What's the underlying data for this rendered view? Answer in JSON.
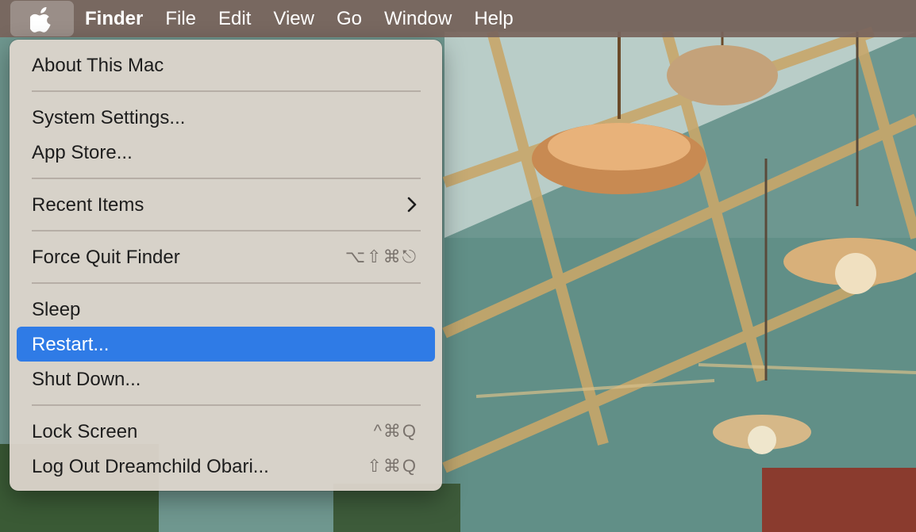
{
  "menubar": {
    "app_name": "Finder",
    "menus": [
      "File",
      "Edit",
      "View",
      "Go",
      "Window",
      "Help"
    ]
  },
  "apple_menu": {
    "items": [
      {
        "label": "About This Mac",
        "shortcut": ""
      },
      {
        "label": "System Settings...",
        "shortcut": ""
      },
      {
        "label": "App Store...",
        "shortcut": ""
      },
      {
        "label": "Recent Items",
        "shortcut": ""
      },
      {
        "label": "Force Quit Finder",
        "shortcut": "⌥⇧⌘⎋"
      },
      {
        "label": "Sleep",
        "shortcut": ""
      },
      {
        "label": "Restart...",
        "shortcut": ""
      },
      {
        "label": "Shut Down...",
        "shortcut": ""
      },
      {
        "label": "Lock Screen",
        "shortcut": "^⌘Q"
      },
      {
        "label": "Log Out Dreamchild Obari...",
        "shortcut": "⇧⌘Q"
      }
    ],
    "highlighted_index": 6
  },
  "colors": {
    "highlight": "#2f7be6",
    "menubar": "#786459"
  }
}
